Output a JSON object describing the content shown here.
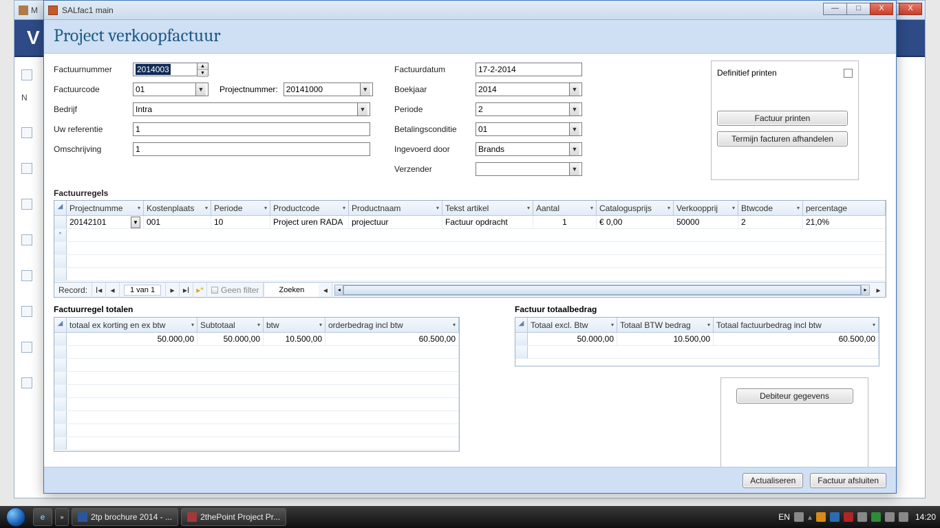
{
  "bg": {
    "title_prefix": "M",
    "banner_letter": "V",
    "sidebar_letters": [
      "",
      "N",
      "",
      "",
      "",
      "",
      "",
      "",
      ""
    ]
  },
  "window": {
    "title": "SALfac1 main",
    "min": "—",
    "max": "□",
    "close": "X"
  },
  "header": {
    "title": "Project verkoopfactuur"
  },
  "form": {
    "left": {
      "factuurnummer_label": "Factuurnummer",
      "factuurnummer_value": "2014003",
      "factuurcode_label": "Factuurcode",
      "factuurcode_value": "01",
      "projectnummer_label": "Projectnummer:",
      "projectnummer_value": "20141000",
      "bedrijf_label": "Bedrijf",
      "bedrijf_value": "Intra",
      "uwref_label": "Uw referentie",
      "uwref_value": "1",
      "omschrijving_label": "Omschrijving",
      "omschrijving_value": "1"
    },
    "right": {
      "factuurdatum_label": "Factuurdatum",
      "factuurdatum_value": "17-2-2014",
      "boekjaar_label": "Boekjaar",
      "boekjaar_value": "2014",
      "periode_label": "Periode",
      "periode_value": "2",
      "betaling_label": "Betalingsconditie",
      "betaling_value": "01",
      "ingevoerd_label": "Ingevoerd door",
      "ingevoerd_value": "Brands",
      "verzender_label": "Verzender",
      "verzender_value": ""
    },
    "box": {
      "definitief_label": "Definitief printen",
      "btn_print": "Factuur printen",
      "btn_termijn": "Termijn facturen afhandelen"
    }
  },
  "regels": {
    "label": "Factuurregels",
    "headers": [
      "Projectnumme",
      "Kostenplaats",
      "Periode",
      "Productcode",
      "Productnaam",
      "Tekst artikel",
      "Aantal",
      "Catalogusprijs",
      "Verkoopprij",
      "Btwcode",
      "percentage"
    ],
    "row": {
      "project": "20142101",
      "kosten": "001",
      "periode": "10",
      "prodcode": "Project uren RADA",
      "prodnaam": "projectuur",
      "tekst": "Factuur opdracht",
      "aantal": "1",
      "catalogus": "€ 0,00",
      "verkoop": "50000",
      "btw": "2",
      "perc": "21,0%"
    },
    "nav": {
      "label": "Record:",
      "pos": "1 van 1",
      "filter": "Geen filter",
      "search": "Zoeken"
    }
  },
  "regeltotalen": {
    "label": "Factuurregel totalen",
    "headers": [
      "totaal ex korting en ex btw",
      "Subtotaal",
      "btw",
      "orderbedrag incl btw"
    ],
    "row": {
      "a": "50.000,00",
      "b": "50.000,00",
      "c": "10.500,00",
      "d": "60.500,00"
    }
  },
  "factuurtotaal": {
    "label": "Factuur totaalbedrag",
    "headers": [
      "Totaal excl. Btw",
      "Totaal BTW bedrag",
      "Totaal factuurbedrag incl btw"
    ],
    "row": {
      "a": "50.000,00",
      "b": "10.500,00",
      "c": "60.500,00"
    }
  },
  "debiteur_btn": "Debiteur gegevens",
  "footer": {
    "actualiseren": "Actualiseren",
    "afsluiten": "Factuur afsluiten"
  },
  "taskbar": {
    "items": [
      "2tp brochure 2014 - ...",
      "2thePoint Project Pr..."
    ],
    "lang": "EN",
    "clock": "14:20"
  }
}
